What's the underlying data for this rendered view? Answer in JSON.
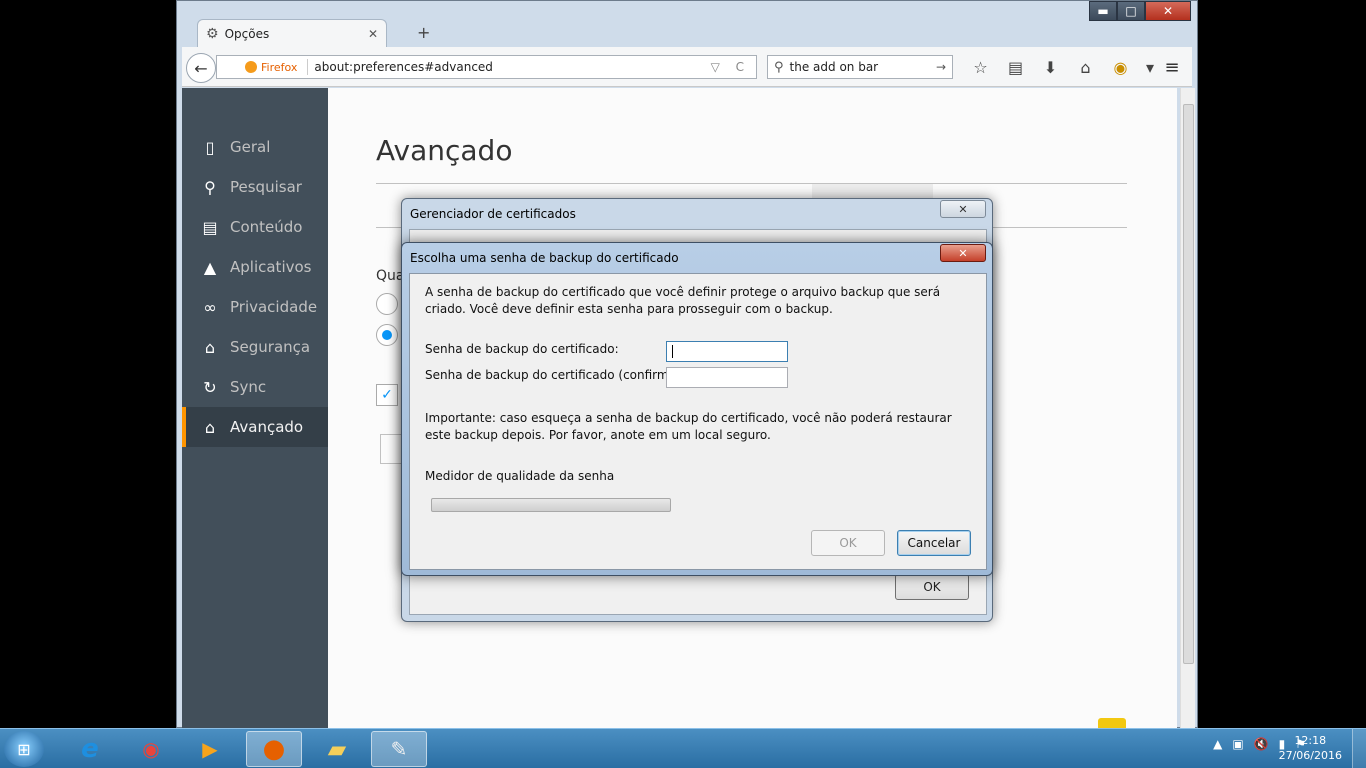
{
  "window": {
    "controls": {
      "minimize": "▬",
      "maximize": "□",
      "close": "✕"
    }
  },
  "tab": {
    "title": "Opções",
    "close": "✕",
    "new_tab": "+"
  },
  "navbar": {
    "identity_label": "Firefox",
    "url": "about:preferences#advanced",
    "url_icons": "▽ C",
    "search_value": "the add on bar",
    "search_go": "→",
    "back_glyph": "←",
    "toolbar_icons": [
      "star-icon",
      "reader-icon",
      "download-icon",
      "home-icon",
      "addon-icon",
      "dropdown-icon"
    ],
    "toolbar_glyphs": [
      "☆",
      "▤",
      "⬇",
      "⌂",
      "◉",
      "▾"
    ],
    "menu_glyph": "≡"
  },
  "sidebar": {
    "items": [
      {
        "label": "Geral",
        "icon": "general-icon",
        "glyph": "▯"
      },
      {
        "label": "Pesquisar",
        "icon": "search-icon",
        "glyph": "⚲"
      },
      {
        "label": "Conteúdo",
        "icon": "content-icon",
        "glyph": "▤"
      },
      {
        "label": "Aplicativos",
        "icon": "applications-icon",
        "glyph": "▲"
      },
      {
        "label": "Privacidade",
        "icon": "privacy-mask-icon",
        "glyph": "∞"
      },
      {
        "label": "Segurança",
        "icon": "security-icon",
        "glyph": "⌂"
      },
      {
        "label": "Sync",
        "icon": "sync-icon",
        "glyph": "↻"
      },
      {
        "label": "Avançado",
        "icon": "advanced-icon",
        "glyph": "⌂",
        "active": true
      }
    ]
  },
  "page": {
    "title": "Avançado",
    "partial_text": "Qua"
  },
  "cert_manager": {
    "title": "Gerenciador de certificados",
    "close": "✕",
    "ok": "OK"
  },
  "backup_dialog": {
    "title": "Escolha uma senha de backup do certificado",
    "close": "✕",
    "description": "A senha de backup do certificado que você definir protege o arquivo backup que será criado. Você deve definir esta senha para prosseguir com o backup.",
    "password_label": "Senha de backup do certificado:",
    "confirm_label": "Senha de backup do certificado (confirmar):",
    "password_value": "",
    "confirm_value": "",
    "important": "Importante: caso esqueça a senha de backup do certificado, você não poderá restaurar este backup depois. Por favor, anote em um local seguro.",
    "meter_label": "Medidor de qualidade da senha",
    "meter_level": 0,
    "ok": "OK",
    "cancel": "Cancelar"
  },
  "taskbar": {
    "start_glyph": "⊞",
    "apps": [
      {
        "name": "ie-icon",
        "glyph": "e",
        "color": "#1e8fe0"
      },
      {
        "name": "chrome-icon",
        "glyph": "◉",
        "color": "#e8453c"
      },
      {
        "name": "media-player-icon",
        "glyph": "▶",
        "color": "#f7a41d"
      },
      {
        "name": "firefox-icon",
        "glyph": "●",
        "color": "#e66000",
        "active": true
      },
      {
        "name": "explorer-folder-icon",
        "glyph": "▰",
        "color": "#f5cf5a"
      },
      {
        "name": "paint-icon",
        "glyph": "✎",
        "color": "#f0f0f0"
      }
    ],
    "tray_glyphs": [
      "▲",
      "▣",
      "🔇",
      "▮",
      "⚑"
    ],
    "time": "12:18",
    "date": "27/06/2016"
  }
}
